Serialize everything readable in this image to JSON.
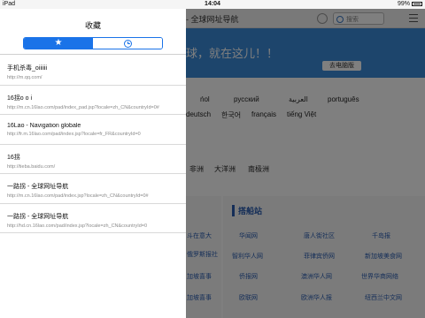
{
  "statusbar": {
    "device": "iPad",
    "time": "14:04",
    "battery": "99%"
  },
  "background_page": {
    "title": "- 全球网址导航",
    "search_placeholder": "搜索",
    "banner_text": "球，就在这儿！！",
    "banner_button": "去电脑版",
    "languages_row1": [
      "ńol",
      "русский",
      "العربية",
      "português"
    ],
    "languages_row2": [
      "deutsch",
      "한국어",
      "français",
      "tiếng Việt"
    ],
    "regions": [
      "非洲",
      "大洋洲",
      "南极洲"
    ],
    "sites_title": "搭船站",
    "sites_left": [
      "斗在意大",
      "俄罗斯报社",
      "加坡喜事",
      "加坡喜事"
    ],
    "sites_rows": [
      [
        "华闻网",
        "唐人街社区",
        "千岛报"
      ],
      [
        "智利华人网",
        "菲律宾侨网",
        "新加坡美食网"
      ],
      [
        "侨报网",
        "澳洲华人网",
        "世界华商网络"
      ],
      [
        "欧联网",
        "欧洲华人报",
        "纽西兰中文网"
      ]
    ]
  },
  "favorites": {
    "title": "收藏",
    "tabs": [
      {
        "icon": "star-icon",
        "active": true
      },
      {
        "icon": "clock-icon",
        "active": false
      }
    ],
    "items": [
      {
        "title": "手机杀毒_oiiiiii",
        "url": "http://m.qq.com/"
      },
      {
        "title": "16拐o o i",
        "url": "http://m.cn.16lao.com/pad/index_pad.jsp?locale=zh_CN&countryId=0#"
      },
      {
        "title": "16Lao - Navigation globale",
        "url": "http://fr.m.16lao.com/pad/index.jsp?locale=fr_FR&countryId=0"
      },
      {
        "title": "16拐",
        "url": "http://tieba.baidu.com/"
      },
      {
        "title": "一路拐 - 全球网址导航",
        "url": "http://m.cn.16lao.com/pad/index.jsp?locale=zh_CN&countryId=0#"
      },
      {
        "title": "一路拐 - 全球网址导航",
        "url": "http://hd.cn.16lao.com/pad/index.jsp?locale=zh_CN&countryId=0"
      }
    ]
  },
  "colors": {
    "accent": "#1a73e8",
    "banner": "#3b8ad9"
  }
}
